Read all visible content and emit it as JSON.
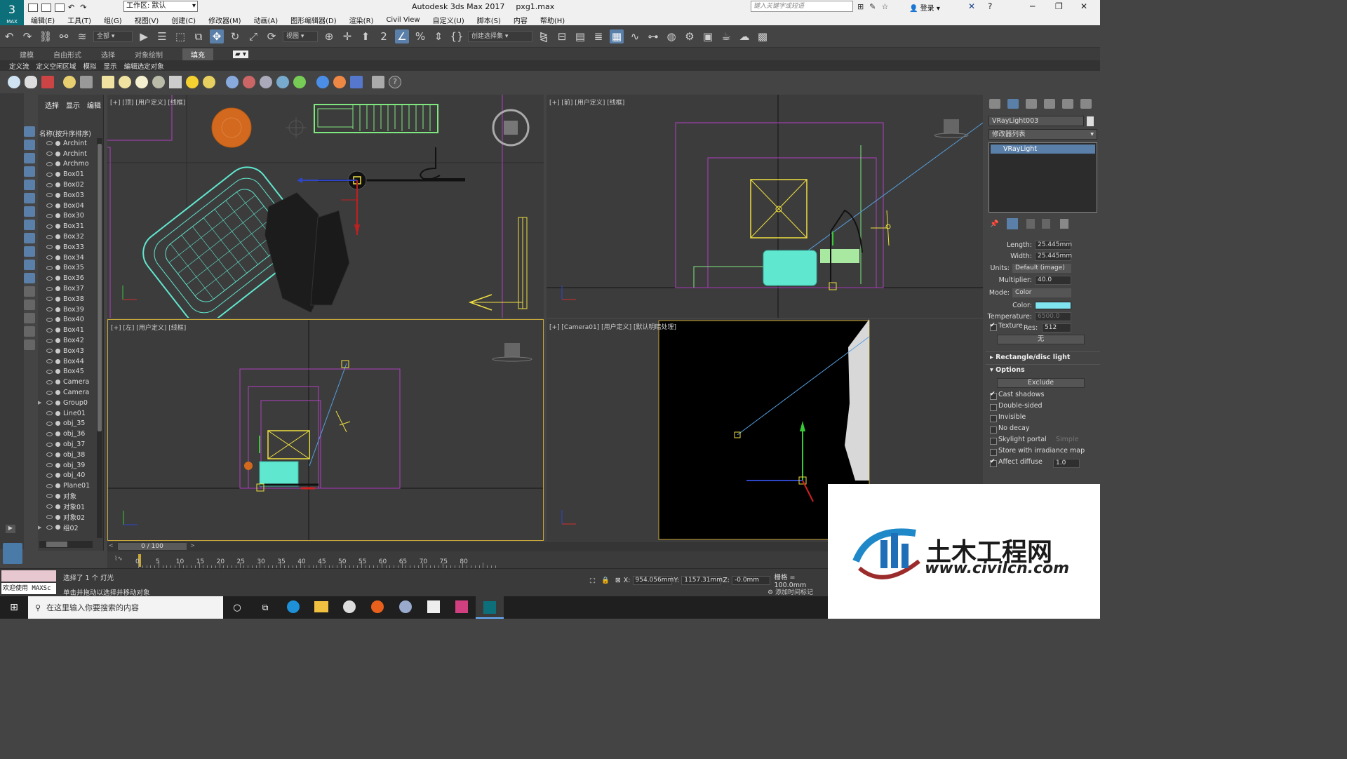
{
  "titlebar": {
    "logo": "3",
    "logo_sub": "MAX",
    "workspace": "工作区: 默认",
    "app_title": "Autodesk 3ds Max 2017",
    "file_name": "pxg1.max",
    "search_placeholder": "键入关键字或短语",
    "login": "登录"
  },
  "menu": [
    "编辑(E)",
    "工具(T)",
    "组(G)",
    "视图(V)",
    "创建(C)",
    "修改器(M)",
    "动画(A)",
    "图形编辑器(D)",
    "渲染(R)",
    "Civil View",
    "自定义(U)",
    "脚本(S)",
    "内容",
    "帮助(H)"
  ],
  "toolbar": {
    "filter": "全部",
    "view_dropdown": "视图",
    "selection_set": "创建选择集"
  },
  "ribbon": {
    "tabs": [
      "建模",
      "自由形式",
      "选择",
      "对象绘制",
      "填充"
    ],
    "active": "填充",
    "subtabs": [
      "定义流",
      "定义空闲区域",
      "模拟",
      "显示",
      "编辑选定对象"
    ]
  },
  "scene": {
    "tabs": [
      "选择",
      "显示",
      "编辑"
    ],
    "sort_label": "名称(按升序排序)",
    "items": [
      "Archint",
      "Archint",
      "Archmo",
      "Box01",
      "Box02",
      "Box03",
      "Box04",
      "Box30",
      "Box31",
      "Box32",
      "Box33",
      "Box34",
      "Box35",
      "Box36",
      "Box37",
      "Box38",
      "Box39",
      "Box40",
      "Box41",
      "Box42",
      "Box43",
      "Box44",
      "Box45",
      "Camera",
      "Camera",
      "Group0",
      "Line01",
      "obj_35",
      "obj_36",
      "obj_37",
      "obj_38",
      "obj_39",
      "obj_40",
      "Plane01",
      "对象",
      "对象01",
      "对象02",
      "组02"
    ]
  },
  "viewports": {
    "top": "[+] [顶] [用户定义] [线框]",
    "front": "[+] [前] [用户定义] [线框]",
    "left": "[+] [左] [用户定义] [线框]",
    "camera": "[+] [Camera01] [用户定义] [默认明暗处理]"
  },
  "panel": {
    "object_name": "VRayLight003",
    "modifier_list": "修改器列表",
    "stack_item": "VRayLight",
    "length_label": "Length:",
    "length": "25.445mm",
    "width_label": "Width:",
    "width": "25.445mm",
    "units_label": "Units:",
    "units": "Default (image)",
    "multiplier_label": "Multiplier:",
    "multiplier": "40.0",
    "mode_label": "Mode:",
    "mode": "Color",
    "color_label": "Color:",
    "color_swatch": "#7fe3f0",
    "temperature_label": "Temperature:",
    "temperature": "6500.0",
    "texture_label": "Texture",
    "res_label": "Res:",
    "res": "512",
    "none_button": "无",
    "rollout_rect": "Rectangle/disc light",
    "rollout_options": "Options",
    "exclude": "Exclude",
    "options": [
      {
        "label": "Cast shadows",
        "checked": true
      },
      {
        "label": "Double-sided",
        "checked": false
      },
      {
        "label": "Invisible",
        "checked": false
      },
      {
        "label": "No decay",
        "checked": false
      },
      {
        "label": "Skylight portal",
        "checked": false
      },
      {
        "label": "Store with irradiance map",
        "checked": false
      },
      {
        "label": "Affect diffuse",
        "checked": true
      }
    ],
    "simple_label": "Simple",
    "affect_diffuse_value": "1.0"
  },
  "timeline": {
    "frame": "0 / 100",
    "ticks": [
      "0",
      "5",
      "10",
      "15",
      "20",
      "25",
      "30",
      "35",
      "40",
      "45",
      "50",
      "55",
      "60",
      "65",
      "70",
      "75",
      "80"
    ]
  },
  "status": {
    "welcome": "欢迎使用 MAXSc",
    "selected": "选择了 1 个 灯光",
    "hint": "单击并拖动以选择并移动对象",
    "x_label": "X:",
    "x": "954.056mm",
    "y_label": "Y:",
    "y": "1157.31mm",
    "z_label": "Z:",
    "z": "-0.0mm",
    "grid": "栅格 = 100.0mm",
    "add_time_tag": "添加时间标记"
  },
  "taskbar": {
    "search_placeholder": "在这里输入你要搜索的内容"
  },
  "brand": {
    "name": "土木工程网",
    "url": "www.civilcn.com"
  },
  "colors": {
    "selected_light": "#f0e040",
    "wireframe_cyan": "#5fe8cf",
    "accent": "#5a7fa8"
  }
}
